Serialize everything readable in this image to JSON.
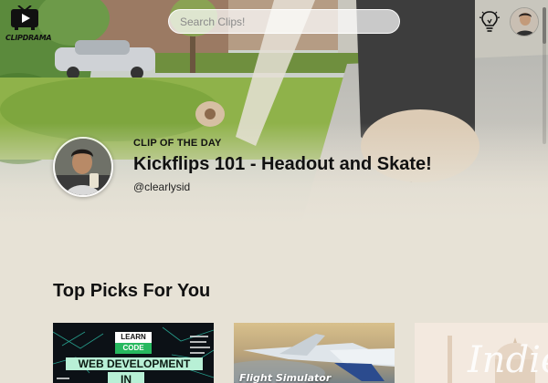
{
  "app": {
    "logo_text": "CLIPDRAMA"
  },
  "search": {
    "placeholder": "Search Clips!"
  },
  "clip_of_the_day": {
    "label": "CLIP OF THE DAY",
    "title": "Kickflips 101 - Headout and Skate!",
    "username": "@clearlysid"
  },
  "top_picks": {
    "heading": "Top Picks For You",
    "cards": [
      {
        "badge_top": "LEARN",
        "badge_bottom": "CODE",
        "title_line1": "WEB DEVELOPMENT",
        "title_line2": "IN"
      },
      {
        "overlay_text": "Flight Simulator"
      },
      {
        "overlay_text": "Indie"
      }
    ]
  },
  "icons": {
    "logo": "tv-play-icon",
    "bulb": "lightbulb-icon",
    "avatar": "user-avatar"
  },
  "colors": {
    "page_bg": "#e7e2d6",
    "text": "#111111"
  }
}
